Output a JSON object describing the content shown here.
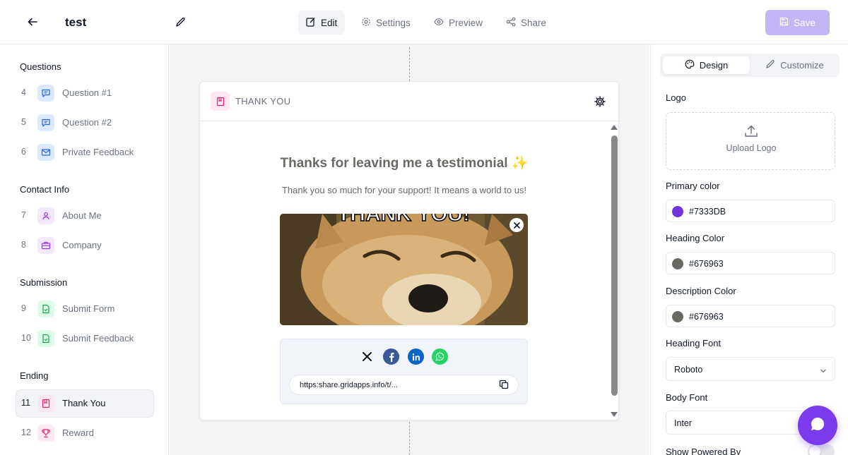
{
  "header": {
    "title": "test",
    "tabs": [
      {
        "label": "Edit",
        "icon": "edit-square-icon",
        "active": true
      },
      {
        "label": "Settings",
        "icon": "gear-icon",
        "active": false
      },
      {
        "label": "Preview",
        "icon": "eye-icon",
        "active": false
      },
      {
        "label": "Share",
        "icon": "share-icon",
        "active": false
      }
    ],
    "save_label": "Save"
  },
  "sidebar": {
    "groups": [
      {
        "title": "Questions",
        "items": [
          {
            "num": "4",
            "label": "Question #1",
            "icon": "chat-bubble-icon"
          },
          {
            "num": "5",
            "label": "Question #2",
            "icon": "chat-bubble-icon"
          },
          {
            "num": "6",
            "label": "Private Feedback",
            "icon": "mail-icon"
          }
        ]
      },
      {
        "title": "Contact Info",
        "items": [
          {
            "num": "7",
            "label": "About Me",
            "icon": "user-icon"
          },
          {
            "num": "8",
            "label": "Company",
            "icon": "briefcase-icon"
          }
        ]
      },
      {
        "title": "Submission",
        "items": [
          {
            "num": "9",
            "label": "Submit Form",
            "icon": "file-check-icon"
          },
          {
            "num": "10",
            "label": "Submit Feedback",
            "icon": "file-check-icon"
          }
        ]
      },
      {
        "title": "Ending",
        "items": [
          {
            "num": "11",
            "label": "Thank You",
            "icon": "bookmark-icon",
            "active": true
          },
          {
            "num": "12",
            "label": "Reward",
            "icon": "trophy-icon"
          }
        ]
      }
    ]
  },
  "card": {
    "header_title": "THANK YOU",
    "heading": "Thanks for leaving me a testimonial ✨",
    "description": "Thank you so much for your support! It means a world to us!",
    "gif_caption": "THANK YOU!",
    "social": [
      "x-icon",
      "facebook-icon",
      "linkedin-icon",
      "whatsapp-icon"
    ],
    "share_url": "https:share.gridapps.info/t/..."
  },
  "design_panel": {
    "tabs": [
      {
        "label": "Design",
        "icon": "palette-icon",
        "active": true
      },
      {
        "label": "Customize",
        "icon": "pencil-icon",
        "active": false
      }
    ],
    "logo_label": "Logo",
    "upload_label": "Upload Logo",
    "primary_color_label": "Primary color",
    "primary_color": "#7333DB",
    "heading_color_label": "Heading Color",
    "heading_color": "#676963",
    "description_color_label": "Description Color",
    "description_color": "#676963",
    "heading_font_label": "Heading Font",
    "heading_font": "Roboto",
    "body_font_label": "Body Font",
    "body_font": "Inter",
    "powered_by_label": "Show Powered By",
    "powered_by_enabled": false
  },
  "colors": {
    "accent": "#7c3aed",
    "save_disabled": "#c4b5f4",
    "canvas_bg": "#f4f4f5"
  }
}
